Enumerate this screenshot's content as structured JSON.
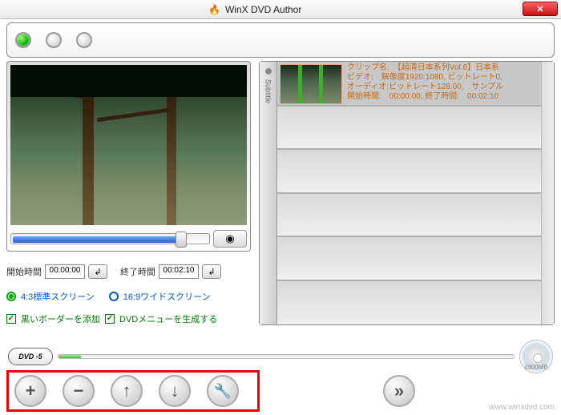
{
  "window": {
    "title": "WinX DVD Author"
  },
  "times": {
    "start_label": "開始時間",
    "start_value": "00:00:00",
    "end_label": "終了時間",
    "end_value": "00:02:10"
  },
  "aspect": {
    "opt43": "4:3標準スクリーン",
    "opt169": "16:9ワイドスクリーン"
  },
  "options": {
    "black_border": "黒いボーダーを添加",
    "dvd_menu": "DVDメニューを生成する"
  },
  "subtitle_tab": "Subtitle",
  "clip": {
    "line1": "クリップ名:　【超清日本系列Vol.6】日本系",
    "line2": "ビデオ:　解像度1920:1080, ビットレート0,",
    "line3": "オーディオ:ビットレート128.00,　サンプル",
    "line4": "開始時間:　00:00:00, 終了時間:　00:02:10"
  },
  "dvd": {
    "label": "DVD -5",
    "capacity": "4300MB"
  },
  "footer": "www.winxdvd.com"
}
